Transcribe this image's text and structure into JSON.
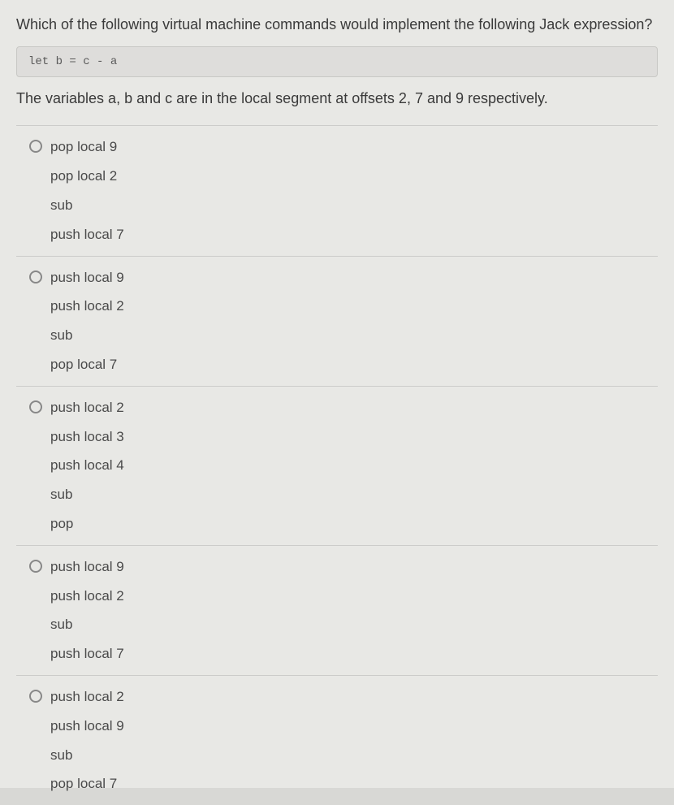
{
  "question": "Which of the following virtual machine commands would implement the following Jack expression?",
  "code": "let b = c - a",
  "subtext": "The variables a, b and c are in the local segment at offsets 2, 7 and 9 respectively.",
  "options": [
    {
      "lines": [
        "pop local 9",
        "pop local 2",
        "sub",
        "push local 7"
      ]
    },
    {
      "lines": [
        "push local 9",
        "push local 2",
        "sub",
        "pop local 7"
      ]
    },
    {
      "lines": [
        "push local 2",
        "push local 3",
        "push local 4",
        "sub",
        "pop"
      ]
    },
    {
      "lines": [
        "push local 9",
        "push local 2",
        "sub",
        "push local 7"
      ]
    },
    {
      "lines": [
        "push local 2",
        "push local 9",
        "sub",
        "pop local 7"
      ]
    }
  ]
}
